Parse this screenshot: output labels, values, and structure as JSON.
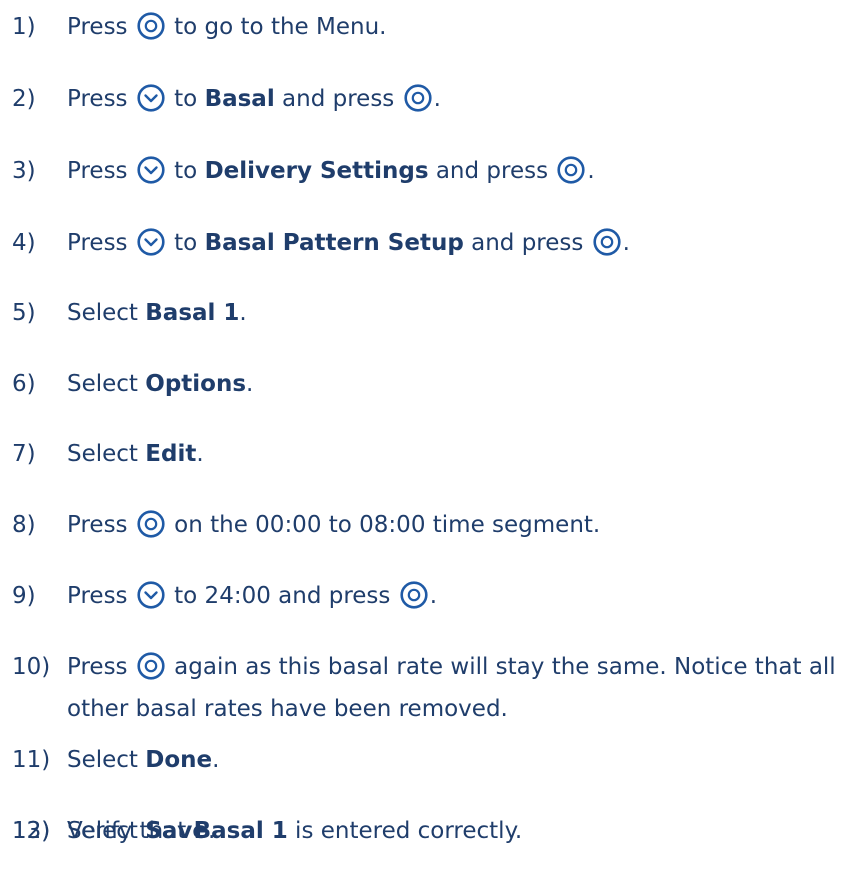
{
  "steps": [
    {
      "num": "1)",
      "parts": [
        [
          "t",
          "Press "
        ],
        [
          "i",
          "select"
        ],
        [
          "t",
          " to go to the Menu."
        ]
      ]
    },
    {
      "num": "2)",
      "parts": [
        [
          "t",
          "Press "
        ],
        [
          "i",
          "down"
        ],
        [
          "t",
          " to "
        ],
        [
          "b",
          "Basal"
        ],
        [
          "t",
          " and press "
        ],
        [
          "i",
          "select"
        ],
        [
          "t",
          "."
        ]
      ]
    },
    {
      "num": "3)",
      "parts": [
        [
          "t",
          "Press "
        ],
        [
          "i",
          "down"
        ],
        [
          "t",
          " to "
        ],
        [
          "b",
          "Delivery Settings"
        ],
        [
          "t",
          " and press "
        ],
        [
          "i",
          "select"
        ],
        [
          "t",
          "."
        ]
      ]
    },
    {
      "num": "4)",
      "parts": [
        [
          "t",
          "Press "
        ],
        [
          "i",
          "down"
        ],
        [
          "t",
          " to "
        ],
        [
          "b",
          "Basal Pattern Setup"
        ],
        [
          "t",
          " and press "
        ],
        [
          "i",
          "select"
        ],
        [
          "t",
          "."
        ]
      ]
    },
    {
      "num": "5)",
      "parts": [
        [
          "t",
          "Select "
        ],
        [
          "b",
          "Basal 1"
        ],
        [
          "t",
          "."
        ]
      ]
    },
    {
      "num": "6)",
      "parts": [
        [
          "t",
          "Select "
        ],
        [
          "b",
          "Options"
        ],
        [
          "t",
          "."
        ]
      ]
    },
    {
      "num": "7)",
      "parts": [
        [
          "t",
          "Select "
        ],
        [
          "b",
          "Edit"
        ],
        [
          "t",
          "."
        ]
      ]
    },
    {
      "num": "8)",
      "parts": [
        [
          "t",
          "Press "
        ],
        [
          "i",
          "select"
        ],
        [
          "t",
          " on the 00:00 to 08:00 time segment."
        ]
      ]
    },
    {
      "num": "9)",
      "parts": [
        [
          "t",
          "Press "
        ],
        [
          "i",
          "down"
        ],
        [
          "t",
          " to 24:00 and press "
        ],
        [
          "i",
          "select"
        ],
        [
          "t",
          "."
        ]
      ]
    },
    {
      "num": "10)",
      "parts": [
        [
          "t",
          "Press "
        ],
        [
          "i",
          "select"
        ],
        [
          "t",
          " again as this basal rate will stay the same. Notice that all other basal rates have been removed."
        ]
      ]
    },
    {
      "num": "11)",
      "parts": [
        [
          "t",
          "Select "
        ],
        [
          "b",
          "Done"
        ],
        [
          "t",
          "."
        ]
      ]
    },
    {
      "num": "12)",
      "parts": [
        [
          "t",
          "Verify that "
        ],
        [
          "b",
          "Basal 1"
        ],
        [
          "t",
          " is entered correctly."
        ]
      ]
    },
    {
      "num": "13)",
      "parts": [
        [
          "t",
          "Select "
        ],
        [
          "b",
          "Save"
        ],
        [
          "t",
          "."
        ]
      ]
    }
  ],
  "icons": {
    "select": "select-button-icon",
    "down": "down-button-icon"
  },
  "colors": {
    "text": "#1f3d6b",
    "icon": "#1f5aa6"
  }
}
